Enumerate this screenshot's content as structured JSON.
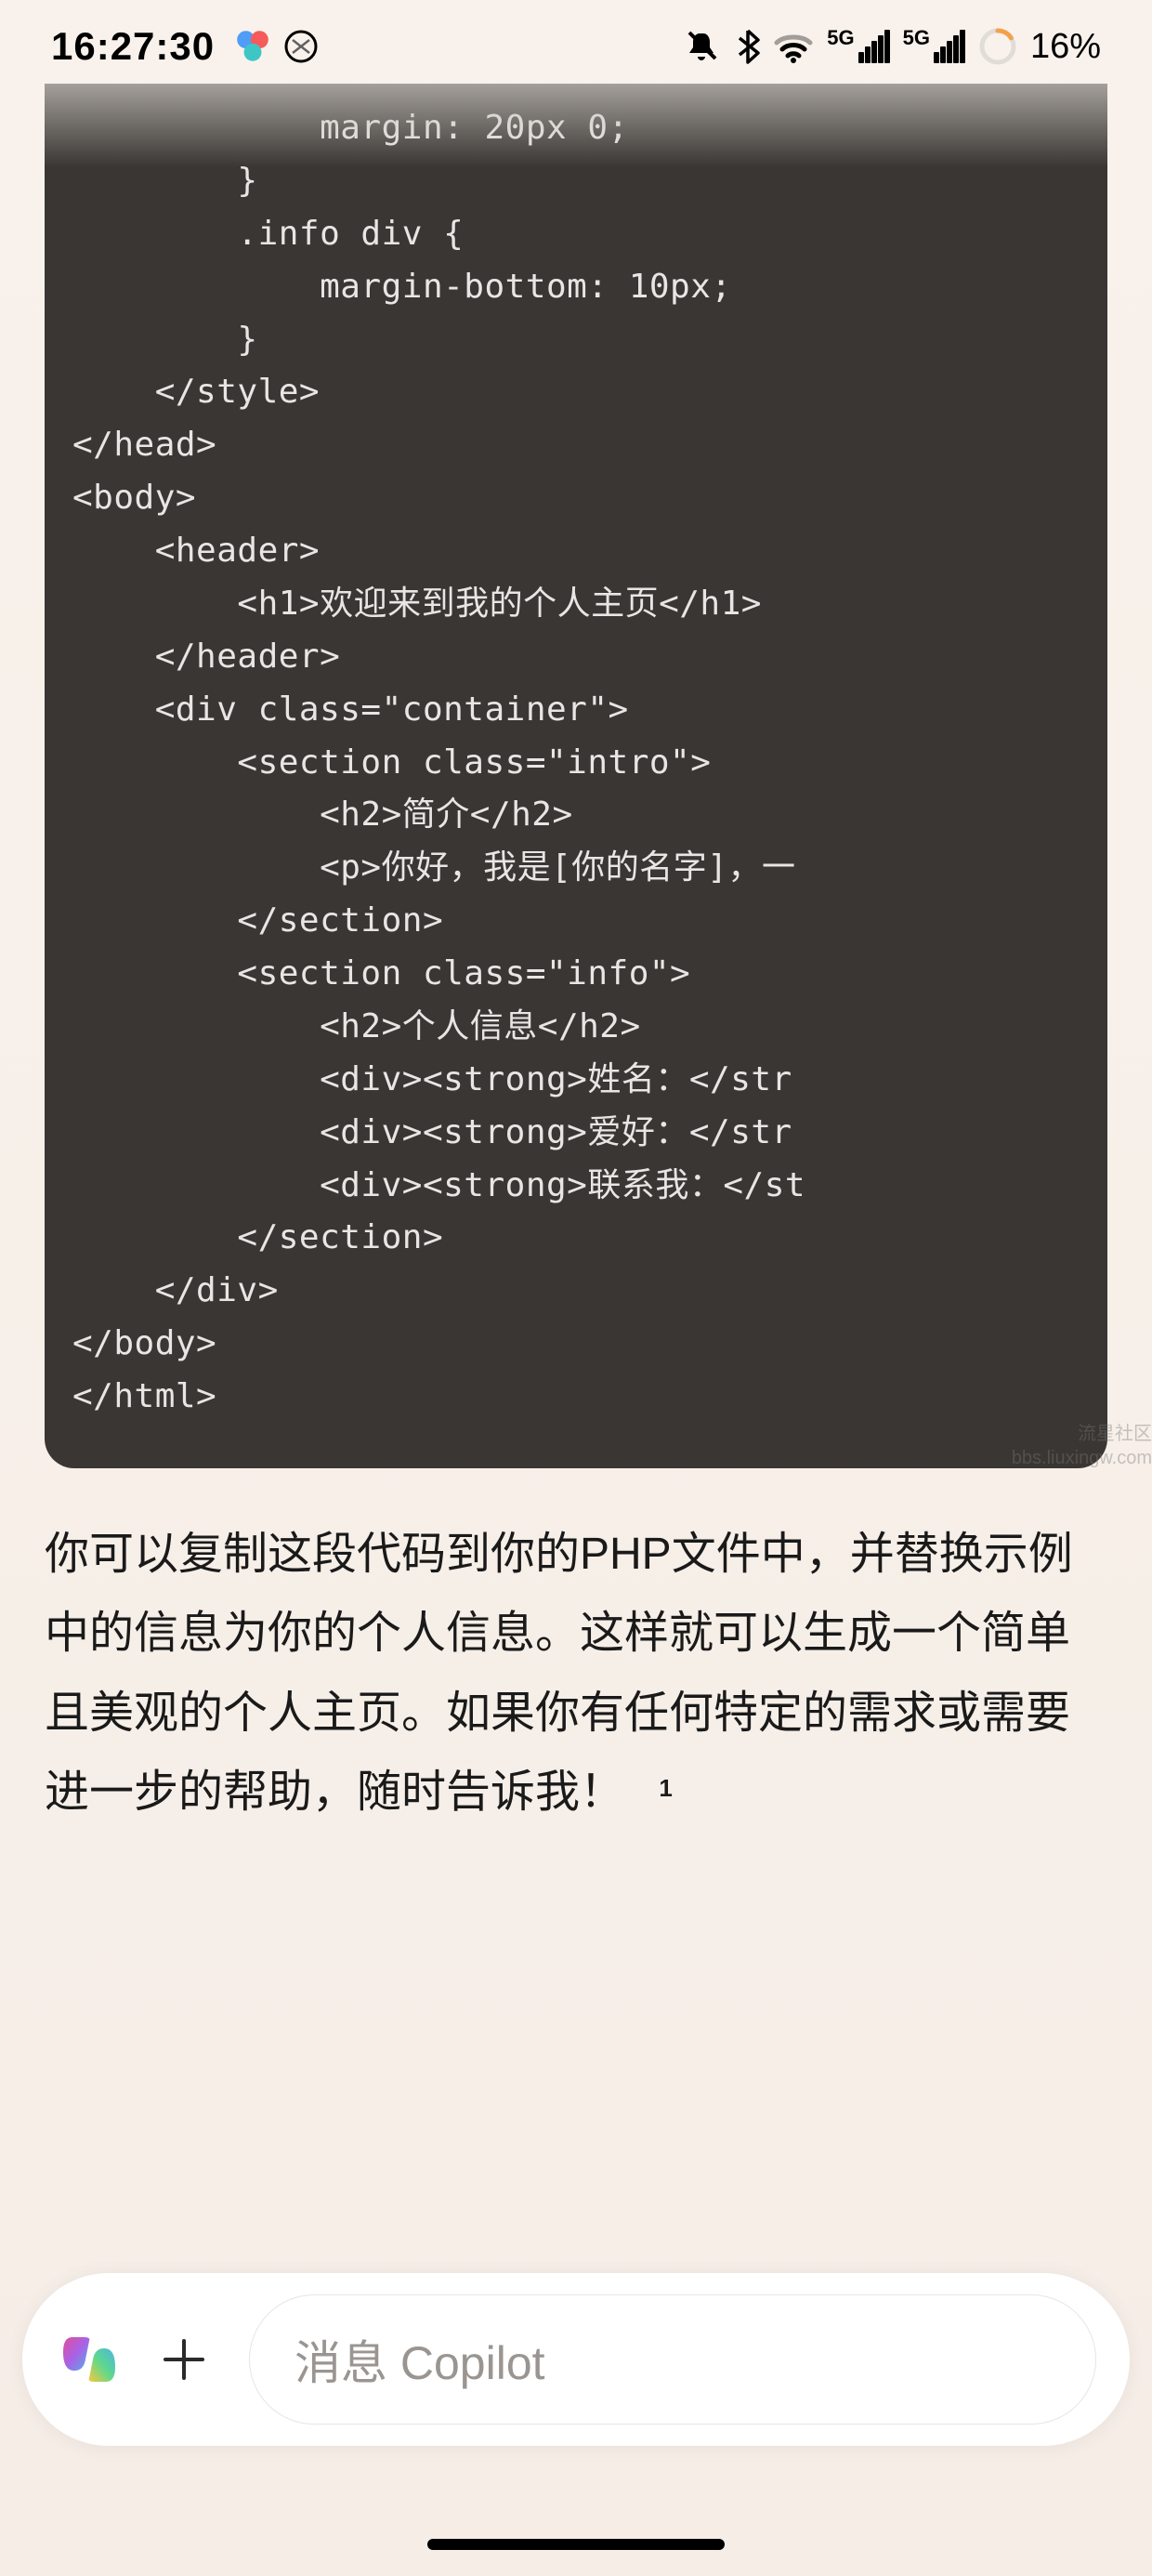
{
  "statusBar": {
    "time": "16:27:30",
    "batteryPercent": "16%",
    "signal5G": "5G"
  },
  "codeBlock": {
    "lines": [
      "            margin: 20px 0;",
      "        }",
      "        .info div {",
      "            margin-bottom: 10px;",
      "        }",
      "    </style>",
      "</head>",
      "<body>",
      "    <header>",
      "        <h1>欢迎来到我的个人主页</h1>",
      "    </header>",
      "    <div class=\"container\">",
      "        <section class=\"intro\">",
      "            <h2>简介</h2>",
      "            <p>你好，我是[你的名字]，一",
      "        </section>",
      "        <section class=\"info\">",
      "            <h2>个人信息</h2>",
      "            <div><strong>姓名：</str",
      "            <div><strong>爱好：</str",
      "            <div><strong>联系我：</st",
      "        </section>",
      "    </div>",
      "</body>",
      "</html>"
    ]
  },
  "message": {
    "text": "你可以复制这段代码到你的PHP文件中，并替换示例中的信息为你的个人信息。这样就可以生成一个简单且美观的个人主页。如果你有任何特定的需求或需要进一步的帮助，随时告诉我！",
    "footnote": "1"
  },
  "inputBar": {
    "placeholder": "消息 Copilot"
  },
  "watermark": {
    "line1": "流星社区",
    "line2": "bbs.liuxingw.com"
  }
}
